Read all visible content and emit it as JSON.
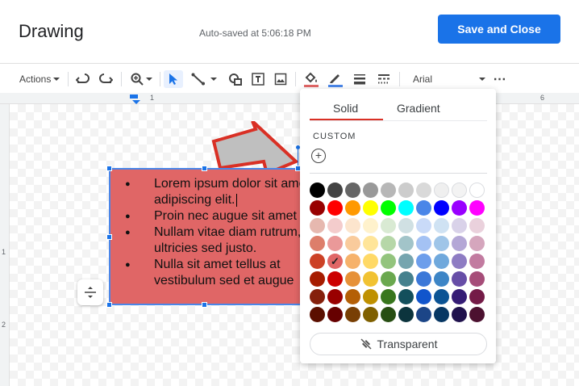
{
  "header": {
    "title": "Drawing",
    "autosave": "Auto-saved at 5:06:18 PM",
    "save_label": "Save and Close"
  },
  "toolbar": {
    "actions_label": "Actions",
    "font_name": "Arial",
    "icons": [
      "undo-icon",
      "redo-icon",
      "zoom-icon",
      "select-icon",
      "line-icon",
      "shape-icon",
      "textbox-icon",
      "image-icon",
      "fill-color-icon",
      "border-color-icon",
      "border-weight-icon",
      "border-dash-icon",
      "more-icon"
    ]
  },
  "ruler": {
    "h_labels": [
      "1",
      "6"
    ],
    "v_labels": [
      "1",
      "2"
    ]
  },
  "textbox": {
    "fill_color": "#e06666",
    "bullets": [
      "Lorem ipsum dolor sit amet, consectetur",
      "adipiscing elit.",
      "Proin nec augue sit amet",
      "Nullam vitae diam rutrum,",
      "ultricies sed justo.",
      "Nulla sit amet tellus at",
      "vestibulum sed et augue"
    ]
  },
  "color_picker": {
    "tabs": [
      "Solid",
      "Gradient"
    ],
    "active_tab": "Solid",
    "custom_label": "CUSTOM",
    "transparent_label": "Transparent",
    "selected": "#e06666",
    "palette": [
      [
        "#000000",
        "#434343",
        "#666666",
        "#999999",
        "#b7b7b7",
        "#cccccc",
        "#d9d9d9",
        "#efefef",
        "#f3f3f3",
        "#ffffff"
      ],
      [
        "#980000",
        "#ff0000",
        "#ff9900",
        "#ffff00",
        "#00ff00",
        "#00ffff",
        "#4a86e8",
        "#0000ff",
        "#9900ff",
        "#ff00ff"
      ],
      [
        "#e6b8af",
        "#f4cccc",
        "#fce5cd",
        "#fff2cc",
        "#d9ead3",
        "#d0e0e3",
        "#c9daf8",
        "#cfe2f3",
        "#d9d2e9",
        "#ead1dc"
      ],
      [
        "#dd7e6b",
        "#ea9999",
        "#f9cb9c",
        "#ffe599",
        "#b6d7a8",
        "#a2c4c9",
        "#a4c2f4",
        "#9fc5e8",
        "#b4a7d6",
        "#d5a6bd"
      ],
      [
        "#cc4125",
        "#e06666",
        "#f6b26b",
        "#ffd966",
        "#93c47d",
        "#76a5af",
        "#6d9eeb",
        "#6fa8dc",
        "#8e7cc3",
        "#c27ba0"
      ],
      [
        "#a61c00",
        "#cc0000",
        "#e69138",
        "#f1c232",
        "#6aa84f",
        "#45818e",
        "#3c78d8",
        "#3d85c6",
        "#674ea7",
        "#a64d79"
      ],
      [
        "#85200c",
        "#990000",
        "#b45f06",
        "#bf9000",
        "#38761d",
        "#134f5c",
        "#1155cc",
        "#0b5394",
        "#351c75",
        "#741b47"
      ],
      [
        "#5b0f00",
        "#660000",
        "#783f04",
        "#7f6000",
        "#274e13",
        "#0c343d",
        "#1c4587",
        "#073763",
        "#20124d",
        "#4c1130"
      ]
    ]
  }
}
